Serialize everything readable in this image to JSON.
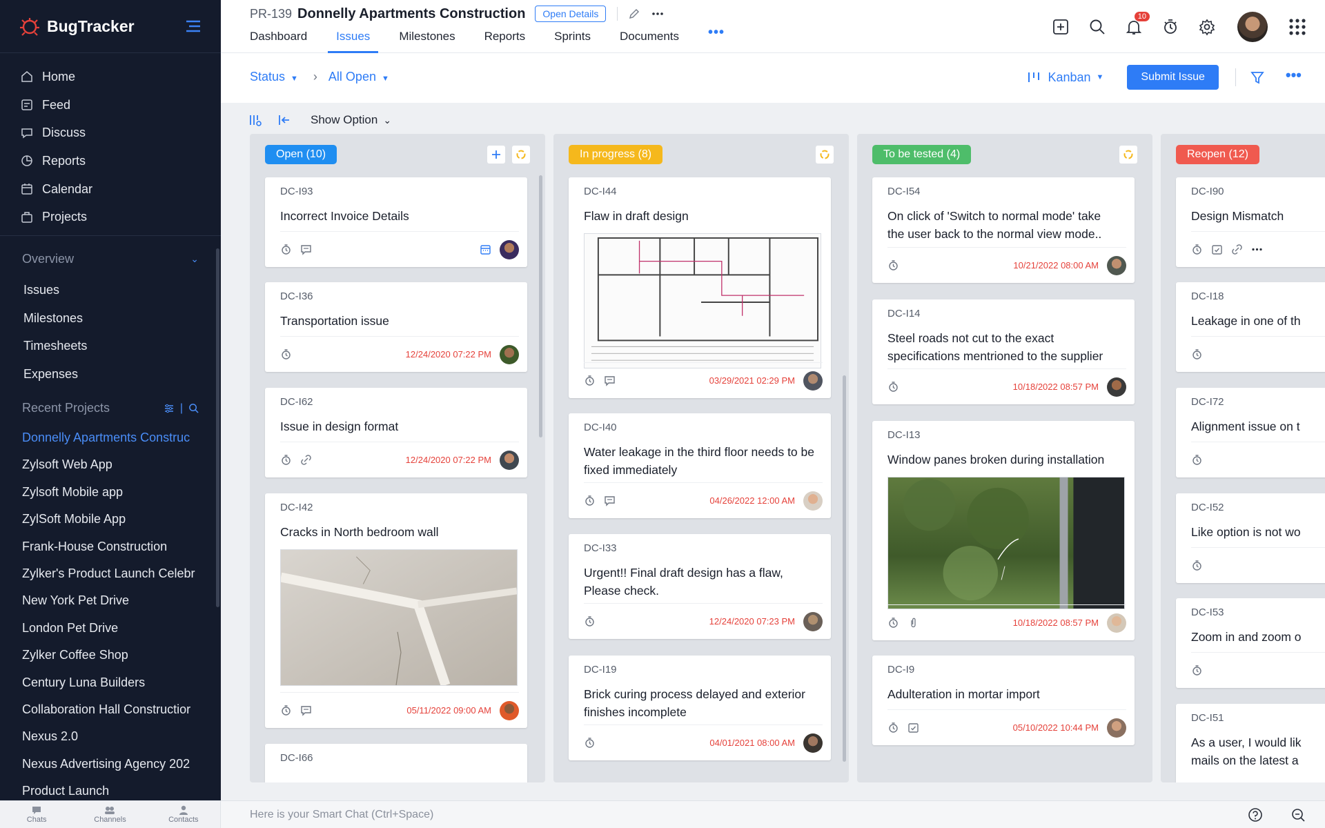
{
  "sidebar": {
    "brand": "BugTracker",
    "main_nav": [
      {
        "label": "Home",
        "icon": "home-icon"
      },
      {
        "label": "Feed",
        "icon": "feed-icon"
      },
      {
        "label": "Discuss",
        "icon": "discuss-icon"
      },
      {
        "label": "Reports",
        "icon": "reports-icon"
      },
      {
        "label": "Calendar",
        "icon": "calendar-icon"
      },
      {
        "label": "Projects",
        "icon": "projects-icon"
      }
    ],
    "overview_label": "Overview",
    "overview_items": [
      "Issues",
      "Milestones",
      "Timesheets",
      "Expenses"
    ],
    "recent_label": "Recent Projects",
    "recent_projects": [
      "Donnelly Apartments Construc",
      "Zylsoft Web App",
      "Zylsoft Mobile app",
      "ZylSoft Mobile App",
      "Frank-House Construction",
      "Zylker's Product Launch Celebr",
      "New York Pet Drive",
      "London Pet Drive",
      "Zylker Coffee Shop",
      "Century Luna Builders",
      "Collaboration Hall Constructior",
      "Nexus 2.0",
      "Nexus Advertising Agency 202",
      "Product Launch"
    ]
  },
  "bottombar": {
    "tabs": [
      "Chats",
      "Channels",
      "Contacts"
    ],
    "smart_chat_placeholder": "Here is your Smart Chat (Ctrl+Space)"
  },
  "header": {
    "project_id": "PR-139",
    "project_title": "Donnelly Apartments Construction",
    "open_details": "Open Details",
    "tabs": [
      "Dashboard",
      "Issues",
      "Milestones",
      "Reports",
      "Sprints",
      "Documents"
    ],
    "active_tab": "Issues",
    "notification_count": "10"
  },
  "subheader": {
    "status_label": "Status",
    "filter_label": "All Open",
    "view_label": "Kanban",
    "submit_label": "Submit Issue"
  },
  "board": {
    "show_option": "Show Option",
    "columns": [
      {
        "title": "Open (10)",
        "color": "#1f8ef1",
        "cards": [
          {
            "id": "DC-I93",
            "title": "Incorrect Invoice Details",
            "due": ""
          },
          {
            "id": "DC-I36",
            "title": "Transportation issue",
            "due": "12/24/2020 07:22 PM"
          },
          {
            "id": "DC-I62",
            "title": "Issue in design format",
            "due": "12/24/2020 07:22 PM"
          },
          {
            "id": "DC-I42",
            "title": "Cracks in North bedroom wall",
            "due": "05/11/2022 09:00 AM"
          },
          {
            "id": "DC-I66",
            "title": "",
            "due": ""
          }
        ]
      },
      {
        "title": "In progress (8)",
        "color": "#f5b81c",
        "cards": [
          {
            "id": "DC-I44",
            "title": "Flaw in draft design",
            "due": "03/29/2021 02:29 PM"
          },
          {
            "id": "DC-I40",
            "title": "Water leakage in the third floor needs to be fixed immediately",
            "due": "04/26/2022 12:00 AM"
          },
          {
            "id": "DC-I33",
            "title": "Urgent!! Final draft design has a flaw, Please check.",
            "due": "12/24/2020 07:23 PM"
          },
          {
            "id": "DC-I19",
            "title": "Brick curing process delayed and exterior finishes incomplete",
            "due": "04/01/2021 08:00 AM"
          }
        ]
      },
      {
        "title": "To be tested (4)",
        "color": "#4ebd6a",
        "cards": [
          {
            "id": "DC-I54",
            "title": "On click of 'Switch to normal mode' take the user back to the normal view mode..",
            "due": "10/21/2022 08:00 AM"
          },
          {
            "id": "DC-I14",
            "title": "Steel roads not cut to the exact specifications mentrioned to the supplier",
            "due": "10/18/2022 08:57 PM"
          },
          {
            "id": "DC-I13",
            "title": "Window panes broken during installation",
            "due": "10/18/2022 08:57 PM"
          },
          {
            "id": "DC-I9",
            "title": "Adulteration in mortar import",
            "due": "05/10/2022 10:44 PM"
          }
        ]
      },
      {
        "title": "Reopen (12)",
        "color": "#f05a4f",
        "cards": [
          {
            "id": "DC-I90",
            "title": "Design Mismatch",
            "due": ""
          },
          {
            "id": "DC-I18",
            "title": "Leakage in one of th",
            "due": ""
          },
          {
            "id": "DC-I72",
            "title": "Alignment issue on t",
            "due": ""
          },
          {
            "id": "DC-I52",
            "title": "Like option is not wo",
            "due": ""
          },
          {
            "id": "DC-I53",
            "title": "Zoom in and zoom o",
            "due": ""
          },
          {
            "id": "DC-I51",
            "title": "As a user, I would lik mails on the latest a",
            "due": ""
          }
        ]
      }
    ]
  }
}
